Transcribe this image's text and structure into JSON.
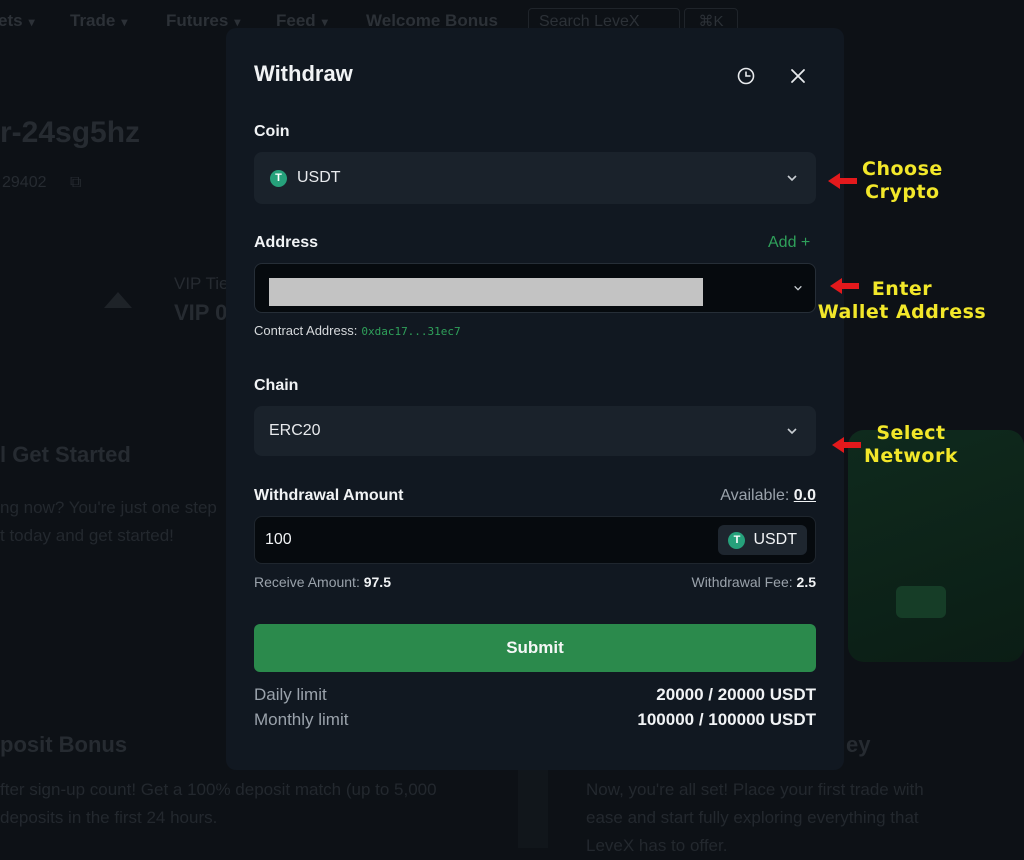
{
  "background": {
    "nav": [
      {
        "label": "ets",
        "chevron": true
      },
      {
        "label": "Trade",
        "chevron": true
      },
      {
        "label": "Futures",
        "chevron": true
      },
      {
        "label": "Feed",
        "chevron": true
      },
      {
        "label": "Welcome Bonus",
        "chevron": false
      }
    ],
    "search_placeholder": "Search LeveX",
    "search_shortcut": "⌘K",
    "username": "r-24sg5hz",
    "user_id": "29402",
    "vip_label": "VIP Tie",
    "vip_value": "VIP 0",
    "get_started_title": "l Get Started",
    "get_started_line1": "ng now? You're just one step",
    "get_started_line2": "t today and get started!",
    "deposit_bonus_title": "posit Bonus",
    "deposit_bonus_line1": "fter sign-up count! Get a 100% deposit match (up to 5,000",
    "deposit_bonus_line2": "deposits in the first 24 hours.",
    "journey_title": "ey",
    "journey_line1": "Now, you're all set! Place your first trade with",
    "journey_line2": "ease and start fully exploring everything that",
    "journey_line3": "LeveX has to offer."
  },
  "modal": {
    "title": "Withdraw",
    "coin_label": "Coin",
    "coin_value": "USDT",
    "coin_icon_letter": "T",
    "address_label": "Address",
    "add_link": "Add +",
    "contract_label": "Contract Address:",
    "contract_value": "0xdac17...31ec7",
    "chain_label": "Chain",
    "chain_value": "ERC20",
    "amount_label": "Withdrawal Amount",
    "available_label": "Available:",
    "available_value": "0.0",
    "amount_value": "100",
    "amount_unit": "USDT",
    "receive_label": "Receive Amount:",
    "receive_value": "97.5",
    "fee_label": "Withdrawal Fee:",
    "fee_value": "2.5",
    "submit_label": "Submit",
    "daily_label": "Daily limit",
    "daily_value": "20000 / 20000 USDT",
    "monthly_label": "Monthly limit",
    "monthly_value": "100000 / 100000 USDT"
  },
  "annotations": {
    "choose_crypto": [
      "Choose",
      "Crypto"
    ],
    "enter_wallet": [
      "Enter",
      "Wallet Address"
    ],
    "select_network": [
      "Select",
      "Network"
    ],
    "text_color": "#f2e72a",
    "arrow_color": "#e3191c"
  },
  "colors": {
    "accent_green": "#2b8a4c",
    "link_green": "#2fa05a",
    "tether_green": "#26a17b"
  }
}
